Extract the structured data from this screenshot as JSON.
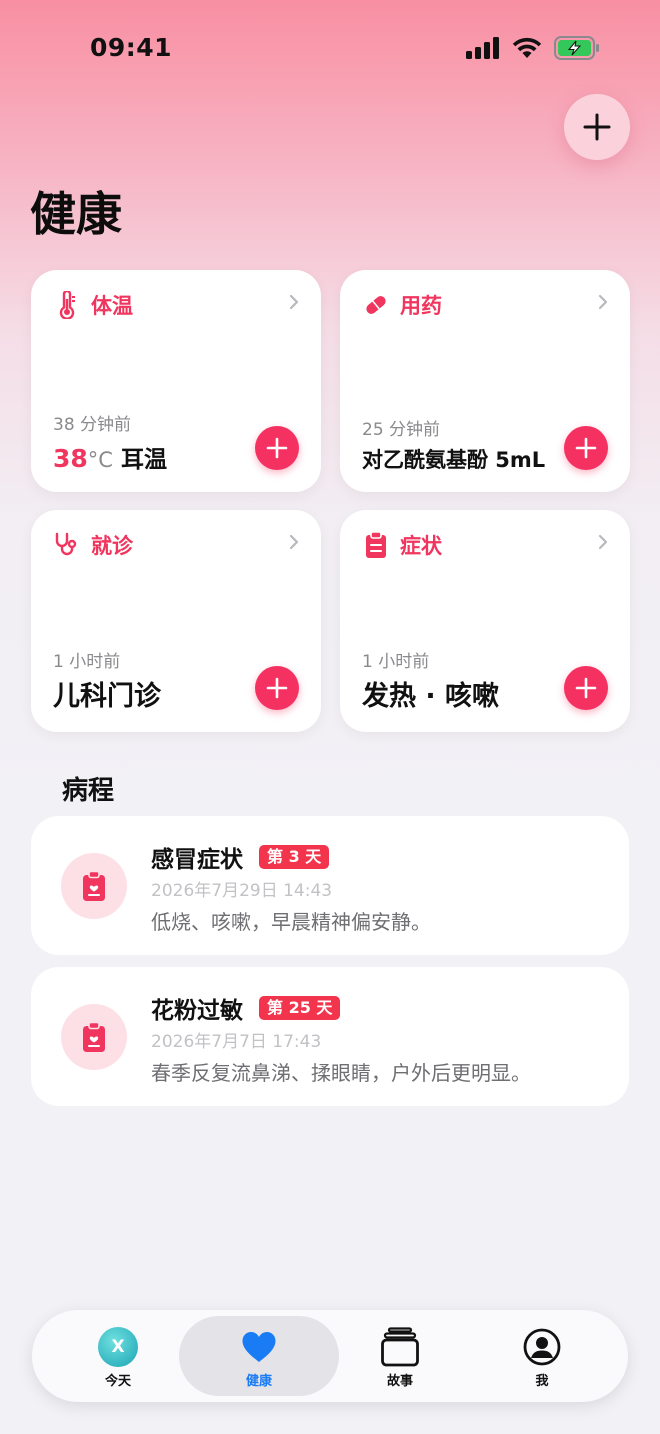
{
  "status_bar": {
    "time": "09:41"
  },
  "header": {
    "title": "健康"
  },
  "cards": {
    "temperature": {
      "title": "体温",
      "time": "38 分钟前",
      "value": "38",
      "unit": "°C",
      "method": "耳温"
    },
    "medication": {
      "title": "用药",
      "time": "25 分钟前",
      "value": "对乙酰氨基酚 5mL"
    },
    "visit": {
      "title": "就诊",
      "time": "1 小时前",
      "value": "儿科门诊"
    },
    "symptom": {
      "title": "症状",
      "time": "1 小时前",
      "value": "发热 · 咳嗽"
    }
  },
  "episodes_section": {
    "title": "病程",
    "items": [
      {
        "title": "感冒症状",
        "badge": "第 3 天",
        "date": "2026年7月29日 14:43",
        "note": "低烧、咳嗽，早晨精神偏安静。"
      },
      {
        "title": "花粉过敏",
        "badge": "第 25 天",
        "date": "2026年7月7日 17:43",
        "note": "春季反复流鼻涕、揉眼睛，户外后更明显。"
      }
    ]
  },
  "tab_bar": {
    "tabs": [
      {
        "label": "今天",
        "avatar_letter": "X"
      },
      {
        "label": "健康"
      },
      {
        "label": "故事"
      },
      {
        "label": "我"
      }
    ],
    "active": "健康"
  },
  "colors": {
    "accent": "#f0365e",
    "add_button": "#f53161",
    "badge": "#f2344c",
    "tab_active": "#1a7cf5"
  }
}
